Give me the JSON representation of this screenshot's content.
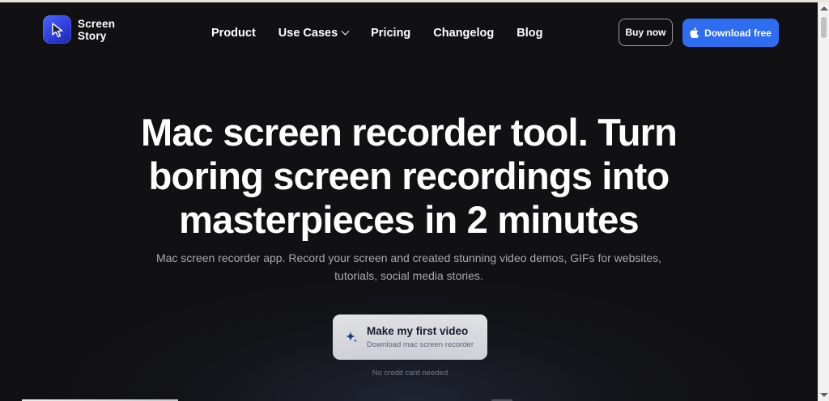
{
  "brand": {
    "name_line1": "Screen",
    "name_line2": "Story",
    "logo_icon": "cursor-arrow-icon",
    "accent_color": "#2f6df0"
  },
  "nav": {
    "items": [
      {
        "label": "Product"
      },
      {
        "label": "Use Cases"
      },
      {
        "label": "Pricing"
      },
      {
        "label": "Changelog"
      },
      {
        "label": "Blog"
      }
    ]
  },
  "actions": {
    "buy_label": "Buy now",
    "download_label": "Download free",
    "download_icon": "apple-icon"
  },
  "hero": {
    "title": "Mac screen recorder tool. Turn boring screen recordings into masterpieces in 2 minutes",
    "subtitle": "Mac screen recorder app. Record your screen and created stunning video demos, GIFs for websites, tutorials, social media stories.",
    "cta_title": "Make my first video",
    "cta_subtitle": "Download mac screen recorder",
    "cta_icon": "sparkle-icon",
    "note": "No credit card needed"
  }
}
